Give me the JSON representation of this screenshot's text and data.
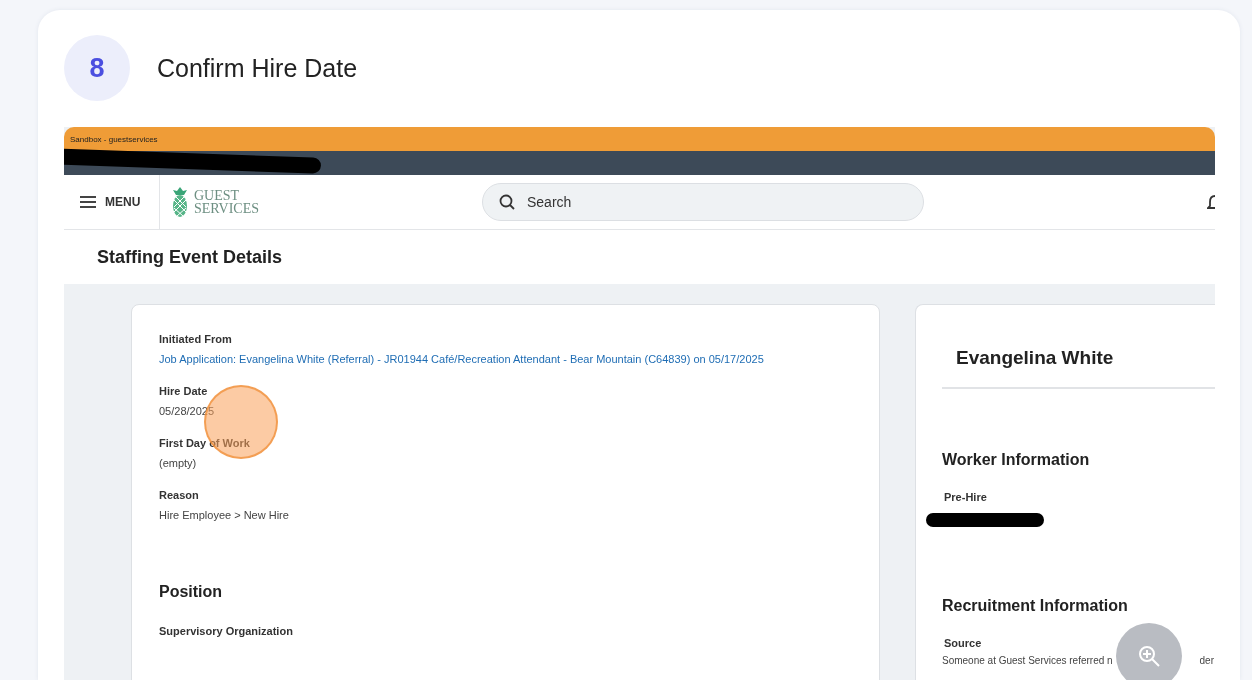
{
  "step": {
    "number": "8",
    "title": "Confirm Hire Date"
  },
  "app": {
    "environment": "Sandbox - guestservices",
    "menu_label": "MENU",
    "logo": {
      "line1": "GUEST",
      "line2": "SERVICES"
    },
    "search": {
      "placeholder": "Search"
    },
    "page_title": "Staffing Event Details",
    "details": [
      {
        "label": "Initiated From",
        "value": "Job Application: Evangelina White (Referral) - JR01944 Café/Recreation Attendant - Bear Mountain (C64839) on 05/17/2025",
        "kind": "link"
      },
      {
        "label": "Hire Date",
        "value": "05/28/2025",
        "kind": "text"
      },
      {
        "label": "First Day of Work",
        "value": "(empty)",
        "kind": "text"
      },
      {
        "label": "Reason",
        "value": "Hire Employee > New Hire",
        "kind": "text"
      }
    ],
    "position": {
      "heading": "Position",
      "label": "Supervisory Organization"
    },
    "worker": {
      "name": "Evangelina White",
      "section": "Worker Information",
      "status": "Pre-Hire"
    },
    "recruitment": {
      "heading": "Recruitment Information",
      "label": "Source",
      "value": "Someone at Guest Services referred n",
      "value_tail": "der"
    }
  }
}
